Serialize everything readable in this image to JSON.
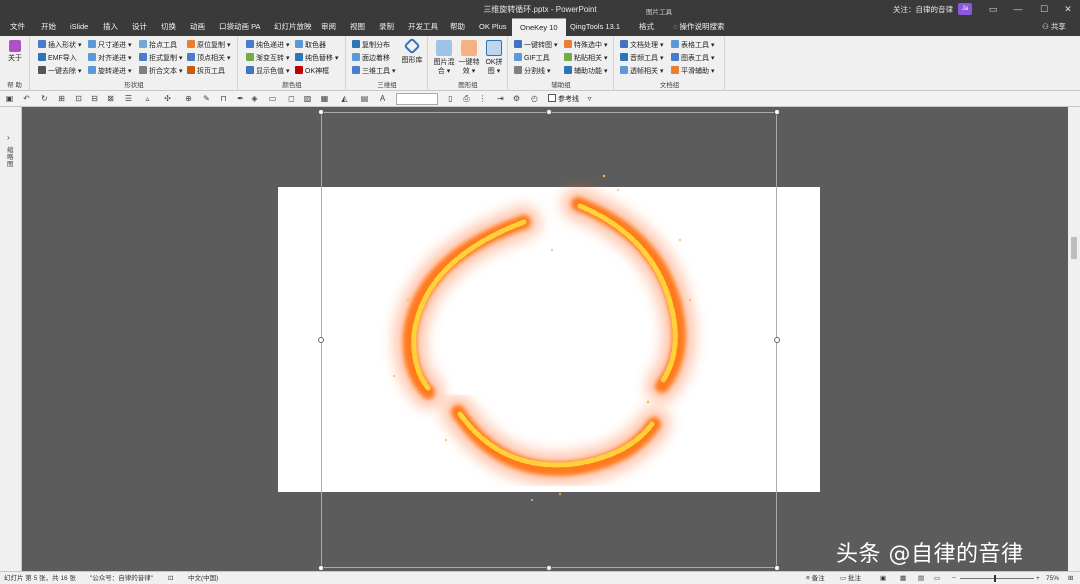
{
  "window": {
    "title": "三维旋转循环.pptx - PowerPoint",
    "follow_text": "关注：自律的音律",
    "badge": "Ja",
    "controls": [
      "▭",
      "—",
      "☐",
      "✕"
    ]
  },
  "tabs": {
    "items": [
      "文件",
      "开始",
      "iSlide",
      "插入",
      "设计",
      "切换",
      "动画",
      "口袋动画 PA",
      "幻灯片放映",
      "审阅",
      "视图",
      "录制",
      "开发工具",
      "帮助",
      "OK Plus",
      "OneKey 10",
      "QingTools 13.1",
      "格式"
    ],
    "active": "OneKey 10",
    "picture_tools": "图片工具",
    "search": "操作说明搜索",
    "share": "共享"
  },
  "ribbon": {
    "help": {
      "label": "关于",
      "group": "帮 助"
    },
    "shape_group": {
      "group": "形状组",
      "buttons": [
        "插入形状 ▾",
        "尺寸递进 ▾",
        "拾点工具",
        "EMF导入",
        "对齐递进 ▾",
        "拒式复制 ▾",
        "一键去除 ▾",
        "旋转递进 ▾",
        "折合文本 ▾",
        "原位复制 ▾",
        "顶点相关 ▾",
        "拆页工具"
      ]
    },
    "color_group": {
      "group": "颜色组",
      "buttons": [
        "纯色递进 ▾",
        "取色器",
        "渐变互转 ▾",
        "纯色替移 ▾",
        "显示色值 ▾",
        "OK神框"
      ]
    },
    "threed_group": {
      "group": "三维组",
      "buttons": [
        "复制分布",
        "面边着移",
        "三维工具 ▾"
      ],
      "big": "图形库"
    },
    "image_group": {
      "group": "图形组",
      "big_buttons": [
        "图片混合 ▾",
        "一键特效 ▾",
        "OK拼图 ▾"
      ]
    },
    "aux_group": {
      "group": "辅助组",
      "buttons": [
        "一键转图 ▾",
        "特殊选中 ▾",
        "GIF工具",
        "粘贴相关 ▾",
        "分割线 ▾",
        "辅助功能 ▾"
      ]
    },
    "doc_group": {
      "group": "文档组",
      "buttons": [
        "文档处理 ▾",
        "表格工具 ▾",
        "音频工具 ▾",
        "图表工具 ▾",
        "透帧相关 ▾",
        "平滑辅助 ▾"
      ]
    }
  },
  "qat": {
    "reference_line": "参考线"
  },
  "left_panel": {
    "toggle": "›",
    "label": "缩略图"
  },
  "watermark": "头条 @自律的音律",
  "status": {
    "slide_info": "幻灯片 第 5 张，共 16 张",
    "account": "\"公众号：自律的音律\"",
    "language": "中文(中国)",
    "notes": "备注",
    "comments": "批注",
    "zoom": "75%"
  },
  "colors": {
    "titlebar": "#3a3a3a",
    "ribbon": "#f0f0f0",
    "canvas": "#5c5c5c",
    "fire_core": "#ffe14a",
    "fire_outer": "#ff5a1a"
  }
}
